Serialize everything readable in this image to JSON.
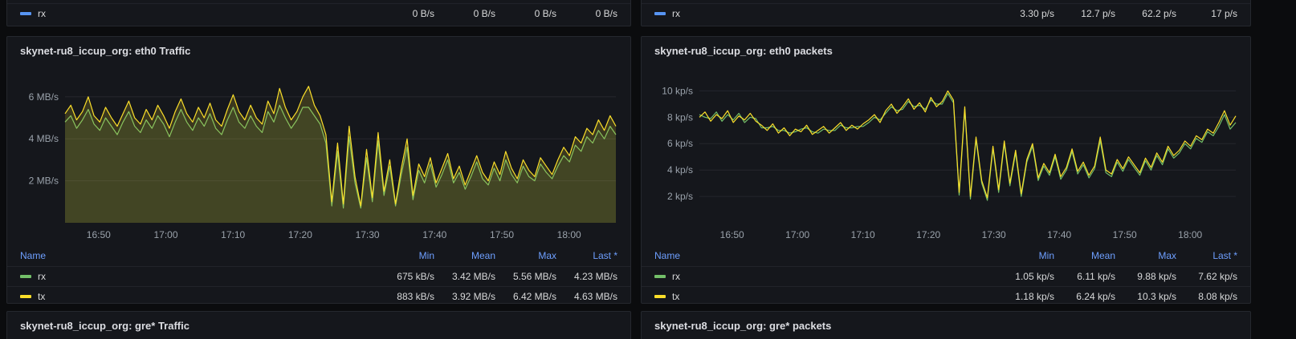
{
  "colors": {
    "legend_header": "#6e9fff",
    "series_green": "#73bf69",
    "series_yellow": "#fade2a",
    "series_blue": "#5794f2",
    "axis_text": "#9aa2ab",
    "grid": "rgba(204,204,220,0.09)"
  },
  "top_panels": [
    {
      "row_label": "rx",
      "color": "#5794f2",
      "values": [
        "0 B/s",
        "0 B/s",
        "0 B/s",
        "0 B/s"
      ]
    },
    {
      "row_label": "rx",
      "color": "#5794f2",
      "values": [
        "3.30 p/s",
        "12.7 p/s",
        "62.2 p/s",
        "17 p/s"
      ]
    }
  ],
  "bottom_panels": [
    {
      "title": "skynet-ru8_iccup_org: gre* Traffic"
    },
    {
      "title": "skynet-ru8_iccup_org: gre* packets"
    }
  ],
  "chart_data": [
    {
      "type": "line",
      "title": "skynet-ru8_iccup_org: eth0 Traffic",
      "unit": "MB/s",
      "x_range": [
        "16:45",
        "18:07"
      ],
      "x_ticks": [
        {
          "pos": 0.061,
          "label": "16:50"
        },
        {
          "pos": 0.183,
          "label": "17:00"
        },
        {
          "pos": 0.305,
          "label": "17:10"
        },
        {
          "pos": 0.427,
          "label": "17:20"
        },
        {
          "pos": 0.549,
          "label": "17:30"
        },
        {
          "pos": 0.671,
          "label": "17:40"
        },
        {
          "pos": 0.793,
          "label": "17:50"
        },
        {
          "pos": 0.915,
          "label": "18:00"
        }
      ],
      "ylim": [
        0,
        7.1
      ],
      "y_ticks": [
        {
          "value": 2,
          "label": "2 MB/s"
        },
        {
          "value": 4,
          "label": "4 MB/s"
        },
        {
          "value": 6,
          "label": "6 MB/s"
        }
      ],
      "series": [
        {
          "name": "rx",
          "color": "#73bf69",
          "fill_opacity": 0.1,
          "values": [
            4.8,
            5.1,
            4.5,
            4.9,
            5.4,
            4.7,
            4.4,
            5.0,
            4.6,
            4.2,
            4.8,
            5.3,
            4.6,
            4.3,
            4.9,
            4.5,
            5.1,
            4.7,
            4.1,
            4.8,
            5.4,
            4.8,
            4.4,
            5.0,
            4.6,
            5.2,
            4.5,
            4.2,
            4.9,
            5.5,
            4.8,
            4.5,
            5.1,
            4.6,
            4.3,
            5.3,
            4.8,
            5.6,
            5.0,
            4.5,
            4.9,
            5.5,
            5.5,
            5.1,
            4.7,
            3.8,
            0.8,
            3.4,
            0.7,
            4.1,
            1.9,
            0.7,
            3.1,
            1.0,
            3.9,
            1.3,
            2.7,
            0.8,
            2.3,
            3.6,
            1.1,
            2.5,
            1.9,
            2.8,
            1.7,
            2.3,
            3.0,
            1.9,
            2.4,
            1.6,
            2.2,
            2.9,
            2.1,
            1.8,
            2.6,
            2.0,
            3.0,
            2.3,
            1.9,
            2.7,
            2.2,
            2.0,
            2.8,
            2.4,
            2.1,
            2.7,
            3.2,
            2.9,
            3.7,
            3.4,
            4.1,
            3.8,
            4.4,
            4.0,
            4.6,
            4.2
          ]
        },
        {
          "name": "tx",
          "color": "#fade2a",
          "fill_opacity": 0.17,
          "values": [
            5.2,
            5.6,
            4.9,
            5.3,
            6.0,
            5.1,
            4.8,
            5.5,
            5.0,
            4.6,
            5.2,
            5.8,
            5.0,
            4.7,
            5.4,
            4.9,
            5.6,
            5.1,
            4.5,
            5.3,
            5.9,
            5.2,
            4.8,
            5.5,
            5.0,
            5.7,
            4.9,
            4.6,
            5.4,
            6.1,
            5.3,
            4.9,
            5.6,
            5.0,
            4.7,
            5.8,
            5.2,
            6.4,
            5.5,
            4.9,
            5.3,
            6.0,
            6.5,
            5.6,
            5.1,
            4.2,
            1.0,
            3.8,
            0.9,
            4.6,
            2.2,
            0.8,
            3.5,
            1.2,
            4.3,
            1.5,
            3.0,
            0.9,
            2.6,
            4.0,
            1.3,
            2.8,
            2.2,
            3.1,
            1.9,
            2.6,
            3.3,
            2.1,
            2.7,
            1.8,
            2.5,
            3.2,
            2.4,
            2.0,
            2.9,
            2.3,
            3.4,
            2.6,
            2.1,
            3.0,
            2.5,
            2.2,
            3.1,
            2.7,
            2.3,
            3.0,
            3.6,
            3.2,
            4.1,
            3.8,
            4.5,
            4.2,
            4.9,
            4.4,
            5.1,
            4.6
          ]
        }
      ],
      "legend": {
        "headers": [
          "Name",
          "Min",
          "Mean",
          "Max",
          "Last *"
        ],
        "rows": [
          {
            "name": "rx",
            "min": "675 kB/s",
            "mean": "3.42 MB/s",
            "max": "5.56 MB/s",
            "last": "4.23 MB/s"
          },
          {
            "name": "tx",
            "min": "883 kB/s",
            "mean": "3.92 MB/s",
            "max": "6.42 MB/s",
            "last": "4.63 MB/s"
          }
        ]
      }
    },
    {
      "type": "line",
      "title": "skynet-ru8_iccup_org: eth0 packets",
      "unit": "kp/s",
      "x_range": [
        "16:45",
        "18:07"
      ],
      "x_ticks": [
        {
          "pos": 0.061,
          "label": "16:50"
        },
        {
          "pos": 0.183,
          "label": "17:00"
        },
        {
          "pos": 0.305,
          "label": "17:10"
        },
        {
          "pos": 0.427,
          "label": "17:20"
        },
        {
          "pos": 0.549,
          "label": "17:30"
        },
        {
          "pos": 0.671,
          "label": "17:40"
        },
        {
          "pos": 0.793,
          "label": "17:50"
        },
        {
          "pos": 0.915,
          "label": "18:00"
        }
      ],
      "ylim": [
        0,
        11.3
      ],
      "y_ticks": [
        {
          "value": 2,
          "label": "2 kp/s"
        },
        {
          "value": 4,
          "label": "4 kp/s"
        },
        {
          "value": 6,
          "label": "6 kp/s"
        },
        {
          "value": 8,
          "label": "8 kp/s"
        },
        {
          "value": 10,
          "label": "10 kp/s"
        }
      ],
      "series": [
        {
          "name": "rx",
          "color": "#73bf69",
          "fill_opacity": 0,
          "values": [
            8.2,
            8.0,
            7.9,
            8.4,
            7.7,
            8.2,
            7.8,
            8.3,
            7.6,
            8.0,
            7.9,
            7.2,
            7.2,
            7.3,
            7.0,
            7.0,
            6.8,
            6.9,
            7.1,
            7.2,
            6.9,
            6.8,
            7.1,
            7.0,
            7.0,
            7.4,
            7.2,
            7.2,
            7.3,
            7.3,
            7.6,
            8.0,
            7.8,
            8.3,
            8.8,
            8.5,
            8.6,
            9.2,
            8.8,
            8.9,
            8.6,
            9.3,
            9.0,
            9.0,
            9.8,
            9.1,
            2.1,
            8.6,
            1.8,
            6.3,
            3.0,
            1.7,
            5.6,
            2.3,
            6.0,
            2.8,
            5.3,
            2.0,
            4.6,
            5.8,
            3.2,
            4.3,
            3.6,
            5.0,
            3.3,
            4.0,
            5.4,
            3.7,
            4.4,
            3.4,
            4.1,
            6.2,
            3.8,
            3.5,
            4.6,
            3.9,
            4.8,
            4.2,
            3.6,
            4.7,
            4.0,
            5.1,
            4.4,
            5.6,
            4.9,
            5.3,
            6.0,
            5.6,
            6.4,
            6.1,
            6.9,
            6.6,
            7.3,
            8.2,
            7.1,
            7.6
          ]
        },
        {
          "name": "tx",
          "color": "#fade2a",
          "fill_opacity": 0,
          "values": [
            8.0,
            8.4,
            7.7,
            8.2,
            7.9,
            8.5,
            7.6,
            8.1,
            7.8,
            8.3,
            7.7,
            7.4,
            7.0,
            7.5,
            6.8,
            7.2,
            6.6,
            7.1,
            6.9,
            7.4,
            6.7,
            7.0,
            7.3,
            6.8,
            7.2,
            7.6,
            7.0,
            7.4,
            7.1,
            7.5,
            7.8,
            8.2,
            7.6,
            8.5,
            9.0,
            8.3,
            8.8,
            9.4,
            8.6,
            9.1,
            8.4,
            9.5,
            8.8,
            9.2,
            10.0,
            9.3,
            2.3,
            8.8,
            2.0,
            6.5,
            3.2,
            1.9,
            5.8,
            2.5,
            6.2,
            3.0,
            5.5,
            2.2,
            4.8,
            6.0,
            3.4,
            4.5,
            3.8,
            5.2,
            3.5,
            4.2,
            5.6,
            3.9,
            4.6,
            3.6,
            4.3,
            6.5,
            4.0,
            3.7,
            4.8,
            4.1,
            5.0,
            4.4,
            3.8,
            4.9,
            4.2,
            5.3,
            4.6,
            5.8,
            5.1,
            5.5,
            6.2,
            5.8,
            6.6,
            6.3,
            7.1,
            6.8,
            7.6,
            8.5,
            7.4,
            8.1
          ]
        }
      ],
      "legend": {
        "headers": [
          "Name",
          "Min",
          "Mean",
          "Max",
          "Last *"
        ],
        "rows": [
          {
            "name": "rx",
            "min": "1.05 kp/s",
            "mean": "6.11 kp/s",
            "max": "9.88 kp/s",
            "last": "7.62 kp/s"
          },
          {
            "name": "tx",
            "min": "1.18 kp/s",
            "mean": "6.24 kp/s",
            "max": "10.3 kp/s",
            "last": "8.08 kp/s"
          }
        ]
      }
    }
  ]
}
